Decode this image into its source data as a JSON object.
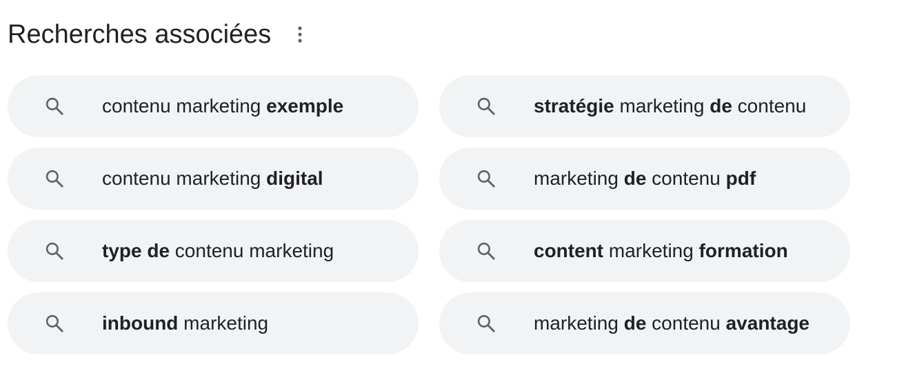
{
  "section": {
    "title": "Recherches associées",
    "more_icon": "more-vert-icon"
  },
  "suggestions": [
    {
      "icon": "search-icon",
      "parts": [
        {
          "text": "contenu marketing ",
          "bold": false
        },
        {
          "text": "exemple",
          "bold": true
        }
      ]
    },
    {
      "icon": "search-icon",
      "parts": [
        {
          "text": "stratégie",
          "bold": true
        },
        {
          "text": " marketing ",
          "bold": false
        },
        {
          "text": "de",
          "bold": true
        },
        {
          "text": " contenu",
          "bold": false
        }
      ]
    },
    {
      "icon": "search-icon",
      "parts": [
        {
          "text": "contenu marketing ",
          "bold": false
        },
        {
          "text": "digital",
          "bold": true
        }
      ]
    },
    {
      "icon": "search-icon",
      "parts": [
        {
          "text": "marketing ",
          "bold": false
        },
        {
          "text": "de",
          "bold": true
        },
        {
          "text": " contenu ",
          "bold": false
        },
        {
          "text": "pdf",
          "bold": true
        }
      ]
    },
    {
      "icon": "search-icon",
      "parts": [
        {
          "text": "type de",
          "bold": true
        },
        {
          "text": " contenu marketing",
          "bold": false
        }
      ]
    },
    {
      "icon": "search-icon",
      "parts": [
        {
          "text": "content",
          "bold": true
        },
        {
          "text": " marketing ",
          "bold": false
        },
        {
          "text": "formation",
          "bold": true
        }
      ]
    },
    {
      "icon": "search-icon",
      "parts": [
        {
          "text": "inbound",
          "bold": true
        },
        {
          "text": " marketing",
          "bold": false
        }
      ]
    },
    {
      "icon": "search-icon",
      "parts": [
        {
          "text": "marketing ",
          "bold": false
        },
        {
          "text": "de",
          "bold": true
        },
        {
          "text": " contenu ",
          "bold": false
        },
        {
          "text": "avantage",
          "bold": true
        }
      ]
    }
  ],
  "colors": {
    "chip_background": "#f1f3f4",
    "text": "#202124",
    "icon": "#5f6368"
  }
}
